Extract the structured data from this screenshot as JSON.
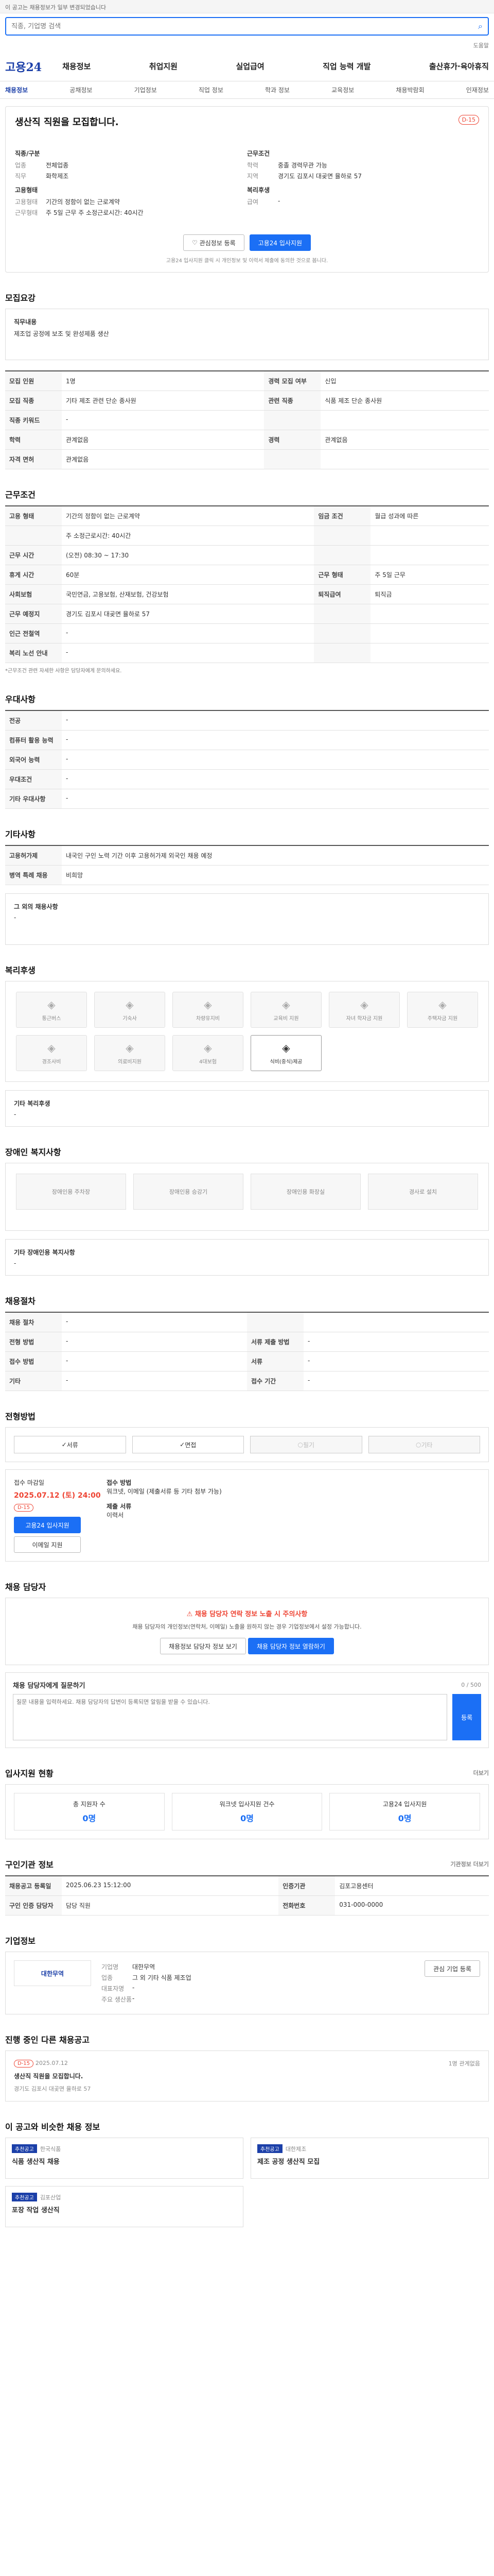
{
  "topbar": {
    "notice": "이 공고는 채용정보가 일부 변경되었습니다"
  },
  "search": {
    "placeholder": "직종, 기업명 검색"
  },
  "help": "도움말",
  "brand": "고용24",
  "menu": [
    "채용정보",
    "취업지원",
    "실업급여",
    "직업 능력 개발",
    "출산휴가·육아휴직"
  ],
  "subnav": [
    "채용정보",
    "공채정보",
    "기업정보",
    "직업 정보",
    "학과 정보",
    "교육정보",
    "채용박람회",
    "인재정보"
  ],
  "job": {
    "title": "생산직 직원을 모집합니다.",
    "dday": "D-15",
    "company_head": "직종/구분",
    "company_rows": [
      {
        "k": "업종",
        "v": "전체업종"
      },
      {
        "k": "직무",
        "v": "화학제조"
      }
    ],
    "cond_head": "근무조건",
    "cond_rows": [
      {
        "k": "학력",
        "v": "중졸 경력무관 가능"
      },
      {
        "k": "지역",
        "v": "경기도 김포시 대곶면 율하로 57"
      }
    ],
    "type_head": "고용형태",
    "type_rows": [
      {
        "k": "고용형태",
        "v": "기간의 정함이 없는 근로계약"
      },
      {
        "k": "근무형태",
        "v": "주 5일 근무 주 소정근로시간: 40시간"
      }
    ],
    "pay_head": "복리후생",
    "pay_rows": [
      {
        "k": "급여",
        "v": "-"
      }
    ],
    "save_label": "관심정보 등록",
    "apply_label": "고용24 입사지원",
    "note": "고용24 입사지원 클릭 시 개인정보 및 이력서 제출에 동의한 것으로 봅니다."
  },
  "s1": {
    "title": "모집요강",
    "label": "직무내용",
    "content": "제조업 공정에 보조 및 완성제품 생산"
  },
  "recruit": [
    {
      "k": "모집 인원",
      "v": "1명",
      "k2": "경력 모집 여부",
      "v2": "신입"
    },
    {
      "k": "모집 직종",
      "v": "기타 제조 관련 단순 종사원",
      "k2": "관련 직종",
      "v2": "식품 제조 단순 종사원"
    },
    {
      "k": "직종 키워드",
      "v": "-",
      "k2": "",
      "v2": ""
    },
    {
      "k": "학력",
      "v": "관계없음",
      "k2": "경력",
      "v2": "관계없음"
    },
    {
      "k": "자격 면허",
      "v": "관계없음",
      "k2": "",
      "v2": ""
    }
  ],
  "s2": {
    "title": "근무조건"
  },
  "work": [
    {
      "k": "고용 형태",
      "v": "기간의 정함이 없는 근로계약",
      "k2": "임금 조건",
      "v2": "월급 성과에 따른"
    },
    {
      "k": "",
      "v": "주 소정근로시간: 40시간",
      "k2": "",
      "v2": ""
    },
    {
      "k": "근무 시간",
      "v": "(오전) 08:30 ~ 17:30",
      "k2": "",
      "v2": ""
    },
    {
      "k": "휴게 시간",
      "v": "60분",
      "k2": "근무 형태",
      "v2": "주 5일 근무"
    },
    {
      "k": "사회보험",
      "v": "국민연금, 고용보험, 산재보험, 건강보험",
      "k2": "퇴직급여",
      "v2": "퇴직금"
    },
    {
      "k": "근무 예정지",
      "v": "경기도 김포시 대곶면 율하로 57",
      "k2": "",
      "v2": ""
    },
    {
      "k": "인근 전철역",
      "v": "-",
      "k2": "",
      "v2": ""
    },
    {
      "k": "복리 노선 안내",
      "v": "-",
      "k2": "",
      "v2": ""
    }
  ],
  "work_note": "*근무조건 관련 자세한 사항은 담당자에게 문의하세요.",
  "s3": {
    "title": "우대사항"
  },
  "prefer": [
    {
      "k": "전공",
      "v": "-"
    },
    {
      "k": "컴퓨터 활용 능력",
      "v": "-"
    },
    {
      "k": "외국어 능력",
      "v": "-"
    },
    {
      "k": "우대조건",
      "v": "-"
    },
    {
      "k": "기타 우대사항",
      "v": "-"
    }
  ],
  "s4": {
    "title": "기타사항"
  },
  "etc": [
    {
      "k": "고용허가제",
      "v": "내국인 구인 노력 기간 이후 고용허가제 외국인 채용 예정"
    },
    {
      "k": "병역 특례 채용",
      "v": "비희망"
    }
  ],
  "etc_box": {
    "label": "그 외의 채용사항",
    "value": "-"
  },
  "s5": {
    "title": "복리후생"
  },
  "welfare": [
    {
      "label": "통근버스",
      "icon": "bus-icon",
      "on": false
    },
    {
      "label": "기숙사",
      "icon": "home-icon",
      "on": false
    },
    {
      "label": "차량유지비",
      "icon": "car-icon",
      "on": false
    },
    {
      "label": "교육비 지원",
      "icon": "book-icon",
      "on": false
    },
    {
      "label": "자녀 학자금 지원",
      "icon": "cap-icon",
      "on": false
    },
    {
      "label": "주택자금 지원",
      "icon": "house-icon",
      "on": false
    },
    {
      "label": "경조사비",
      "icon": "gift-icon",
      "on": false
    },
    {
      "label": "의료비지원",
      "icon": "cross-icon",
      "on": false
    },
    {
      "label": "4대보험",
      "icon": "shield-icon",
      "on": false
    },
    {
      "label": "식비(중식)제공",
      "icon": "meal-icon",
      "on": true
    }
  ],
  "welfare_other": {
    "label": "기타 복리후생",
    "value": "-"
  },
  "s6": {
    "title": "장애인 복지사항"
  },
  "disability": [
    "장애인용 주차장",
    "장애인용 승강기",
    "장애인용 화장실",
    "경사로 설치"
  ],
  "dis_other": {
    "label": "기타 장애인용 복지사항",
    "value": "-"
  },
  "s7": {
    "title": "채용절차"
  },
  "process": [
    {
      "k": "채용 절차",
      "v": "-",
      "k2": "",
      "v2": ""
    },
    {
      "k": "전형 방법",
      "v": "-",
      "k2": "서류 제출 방법",
      "v2": "-"
    },
    {
      "k": "접수 방법",
      "v": "-",
      "k2": "서류",
      "v2": "-"
    },
    {
      "k": "기타",
      "v": "-",
      "k2": "접수 기간",
      "v2": "-"
    }
  ],
  "s8": {
    "title": "전형방법"
  },
  "methods": [
    {
      "label": "서류",
      "on": true
    },
    {
      "label": "면접",
      "on": true
    },
    {
      "label": "필기",
      "on": false
    },
    {
      "label": "기타",
      "on": false
    }
  ],
  "apply": {
    "label": "접수 마감일",
    "deadline": "2025.07.12 (토) 24:00",
    "dday": "D-15",
    "btn1": "고용24 입사지원",
    "btn2": "이메일 지원",
    "method_label": "접수 방법",
    "method": "워크넷, 이메일 (제출서류 등 기타 첨부 가능)",
    "doc_label": "제출 서류",
    "doc": "이력서"
  },
  "s9": {
    "title": "채용 담당자"
  },
  "warning": {
    "title": "채용 담당자 연락 정보 노출 시 주의사항",
    "text": "채용 담당자의 개인정보(연락처, 이메일) 노출을 원하지 않는 경우 기업정보에서 설정 가능합니다.",
    "btn1": "채용정보 담당자 정보 보기",
    "btn2": "채용 담당자 정보 열람하기"
  },
  "qa": {
    "title": "채용 담당자에게 질문하기",
    "placeholder": "질문 내용을 입력하세요. 채용 담당자의 답변이 등록되면 알림을 받을 수 있습니다.",
    "submit": "등록",
    "count": "0 / 500"
  },
  "s10": {
    "title": "입사지원 현황",
    "more": "더보기"
  },
  "stats": [
    {
      "label": "총 지원자 수",
      "value": "0명"
    },
    {
      "label": "워크넷 입사지원 건수",
      "value": "0명"
    },
    {
      "label": "고용24 입사지원",
      "value": "0명"
    }
  ],
  "s11": {
    "title": "구인기관 정보",
    "more": "기관정보 더보기"
  },
  "agency": [
    {
      "k": "채용공고 등록일",
      "v": "2025.06.23 15:12:00",
      "k2": "인증기관",
      "v2": "김포고용센터"
    },
    {
      "k": "구인 인증 담당자",
      "v": "담당 직원",
      "k2": "전화번호",
      "v2": "031-000-0000"
    }
  ],
  "s12": {
    "title": "기업정보"
  },
  "company": {
    "logo": "대한무역",
    "rows": [
      {
        "k": "기업명",
        "v": "대한무역"
      },
      {
        "k": "업종",
        "v": "그 외 기타 식품 제조업"
      },
      {
        "k": "대표자명",
        "v": "-"
      },
      {
        "k": "주요 생산품",
        "v": "-"
      }
    ],
    "btn": "관심 기업 등록"
  },
  "s13": {
    "title": "진행 중인 다른 채용공고"
  },
  "other": {
    "dday": "D-15",
    "date": "2025.07.12",
    "title": "생산직 직원을 모집합니다.",
    "info": "경기도 김포시 대곶면 율하로 57",
    "tag1": "1명",
    "tag2": "관계없음"
  },
  "s14": {
    "title": "이 공고와 비슷한 채용 정보"
  },
  "similar": [
    {
      "tag": "추천공고",
      "company": "한국식품",
      "title": "식품 생산직 채용"
    },
    {
      "tag": "추천공고",
      "company": "대한제조",
      "title": "제조 공정 생산직 모집"
    },
    {
      "tag": "추천공고",
      "company": "김포산업",
      "title": "포장 작업 생산직"
    }
  ]
}
